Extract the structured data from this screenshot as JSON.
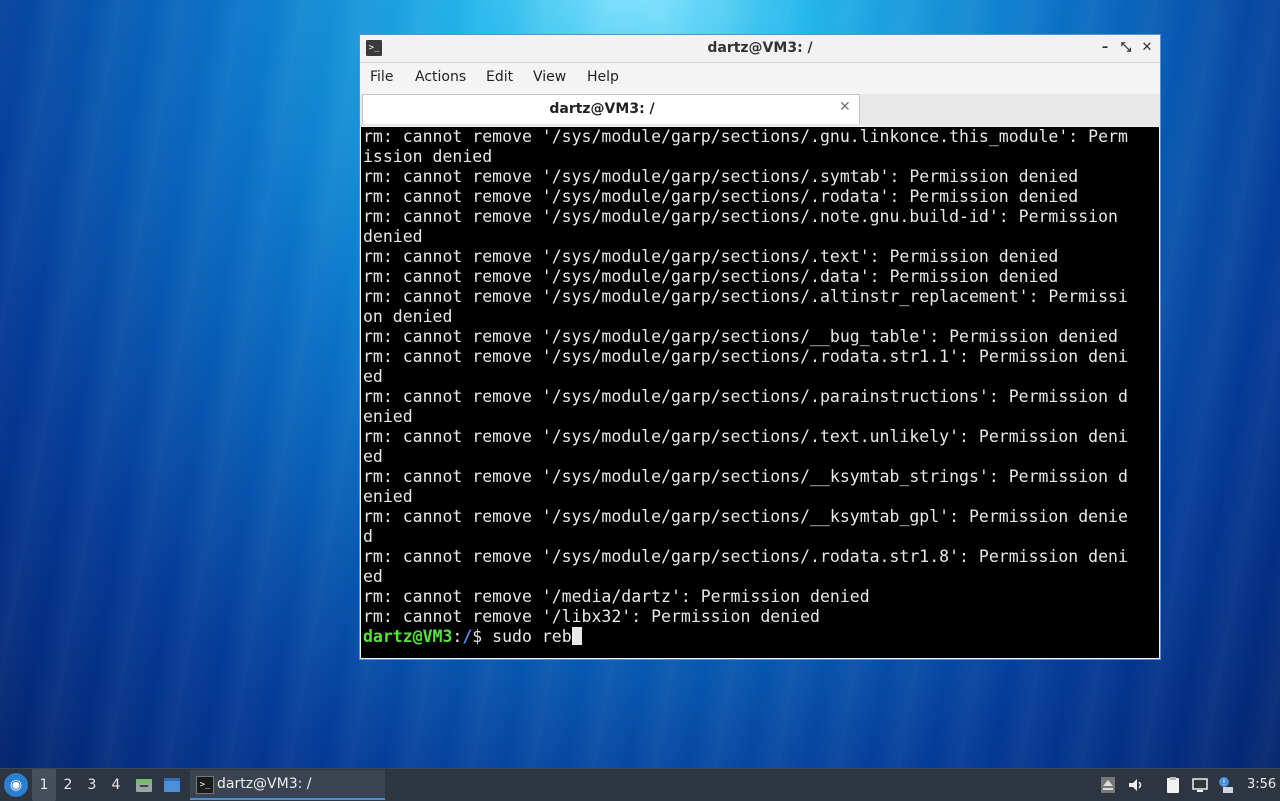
{
  "window": {
    "title": "dartz@VM3: /",
    "icon": "terminal-icon",
    "controls": {
      "minimize": "–",
      "maximize": "⤡",
      "close": "✕"
    }
  },
  "menubar": {
    "file": "File",
    "actions": "Actions",
    "edit": "Edit",
    "view": "View",
    "help": "Help"
  },
  "tab": {
    "label": "dartz@VM3: /",
    "close": "✕"
  },
  "terminal": {
    "lines": [
      "rm: cannot remove '/sys/module/garp/sections/.gnu.linkonce.this_module': Perm",
      "ission denied",
      "rm: cannot remove '/sys/module/garp/sections/.symtab': Permission denied",
      "rm: cannot remove '/sys/module/garp/sections/.rodata': Permission denied",
      "rm: cannot remove '/sys/module/garp/sections/.note.gnu.build-id': Permission",
      "denied",
      "rm: cannot remove '/sys/module/garp/sections/.text': Permission denied",
      "rm: cannot remove '/sys/module/garp/sections/.data': Permission denied",
      "rm: cannot remove '/sys/module/garp/sections/.altinstr_replacement': Permissi",
      "on denied",
      "rm: cannot remove '/sys/module/garp/sections/__bug_table': Permission denied",
      "rm: cannot remove '/sys/module/garp/sections/.rodata.str1.1': Permission deni",
      "ed",
      "rm: cannot remove '/sys/module/garp/sections/.parainstructions': Permission d",
      "enied",
      "rm: cannot remove '/sys/module/garp/sections/.text.unlikely': Permission deni",
      "ed",
      "rm: cannot remove '/sys/module/garp/sections/__ksymtab_strings': Permission d",
      "enied",
      "rm: cannot remove '/sys/module/garp/sections/__ksymtab_gpl': Permission denie",
      "d",
      "rm: cannot remove '/sys/module/garp/sections/.rodata.str1.8': Permission deni",
      "ed",
      "rm: cannot remove '/media/dartz': Permission denied",
      "rm: cannot remove '/libx32': Permission denied"
    ],
    "prompt": {
      "user": "dartz@VM3",
      "colon": ":",
      "path": "/",
      "dollar": "$ ",
      "command": "sudo reb"
    }
  },
  "taskbar": {
    "start_icon": "lubuntu-start-icon",
    "workspaces": [
      "1",
      "2",
      "3",
      "4"
    ],
    "task": {
      "label": "dartz@VM3: /"
    },
    "clock": "3:56"
  }
}
